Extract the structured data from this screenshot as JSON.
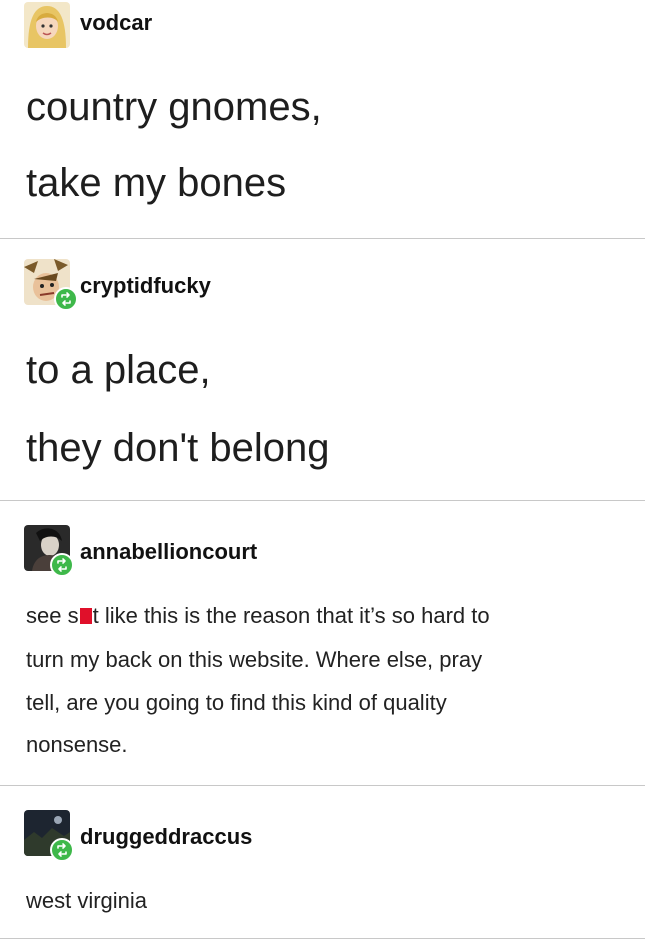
{
  "posts": [
    {
      "username": "vodcar",
      "lines": [
        "country gnomes,",
        "take my bones"
      ],
      "reblog": false,
      "avatar_icon": "blonde-person-avatar"
    },
    {
      "username": "cryptidfucky",
      "lines": [
        "to a place,",
        "they don't belong"
      ],
      "reblog": true,
      "avatar_icon": "cartoon-face-avatar"
    },
    {
      "username": "annabellioncourt",
      "lines": [
        "see s",
        "t like this is the reason that it’s so hard to",
        "turn my back on this website. Where else, pray",
        "tell, are you going to find this kind of quality",
        "nonsense."
      ],
      "reblog": true,
      "avatar_icon": "dark-portrait-avatar"
    },
    {
      "username": "druggeddraccus",
      "lines": [
        "west virginia"
      ],
      "reblog": true,
      "avatar_icon": "night-scene-avatar"
    }
  ],
  "colors": {
    "reblog_badge": "#3eb84a",
    "censor_block": "#e0102a",
    "divider": "#c8c8c8"
  },
  "icons": {
    "reblog": "reblog-icon"
  }
}
